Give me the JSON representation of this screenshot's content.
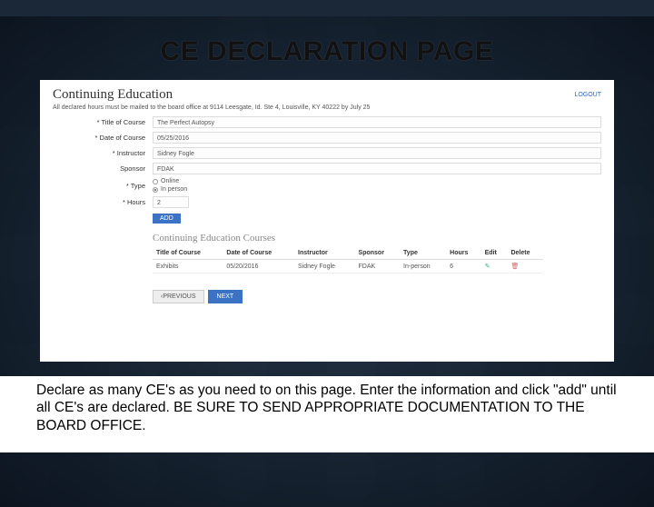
{
  "slide": {
    "title": "CE DECLARATION PAGE",
    "caption": "Declare as many CE's as you need to on this page.  Enter the information and click \"add\" until all CE's are declared.  BE SURE TO SEND APPROPRIATE DOCUMENTATION TO THE BOARD OFFICE."
  },
  "app": {
    "heading": "Continuing Education",
    "logout": "LOGOUT",
    "notice": "All declared hours must be mailed to the board office at 9114 Leesgate, Id. Ste 4, Louisville, KY 40222 by July 25",
    "form": {
      "title_label": "Title of Course",
      "title_value": "The Perfect Autopsy",
      "date_label": "Date of Course",
      "date_value": "05/25/2016",
      "instructor_label": "Instructor",
      "instructor_value": "Sidney Fogle",
      "sponsor_label": "Sponsor",
      "sponsor_value": "FDAK",
      "type_label": "Type",
      "type_options": [
        "Online",
        "In person"
      ],
      "type_selected": "In person",
      "hours_label": "Hours",
      "hours_value": "2",
      "add_label": "ADD"
    },
    "subheading": "Continuing Education Courses",
    "table": {
      "headers": [
        "Title of Course",
        "Date of Course",
        "Instructor",
        "Sponsor",
        "Type",
        "Hours",
        "Edit",
        "Delete"
      ],
      "rows": [
        {
          "title": "Exhibits",
          "date": "05/20/2016",
          "instructor": "Sidney Fogle",
          "sponsor": "FDAK",
          "type": "In-person",
          "hours": "6"
        }
      ]
    },
    "nav": {
      "prev": "‹PREVIOUS",
      "next": "NEXT"
    }
  }
}
